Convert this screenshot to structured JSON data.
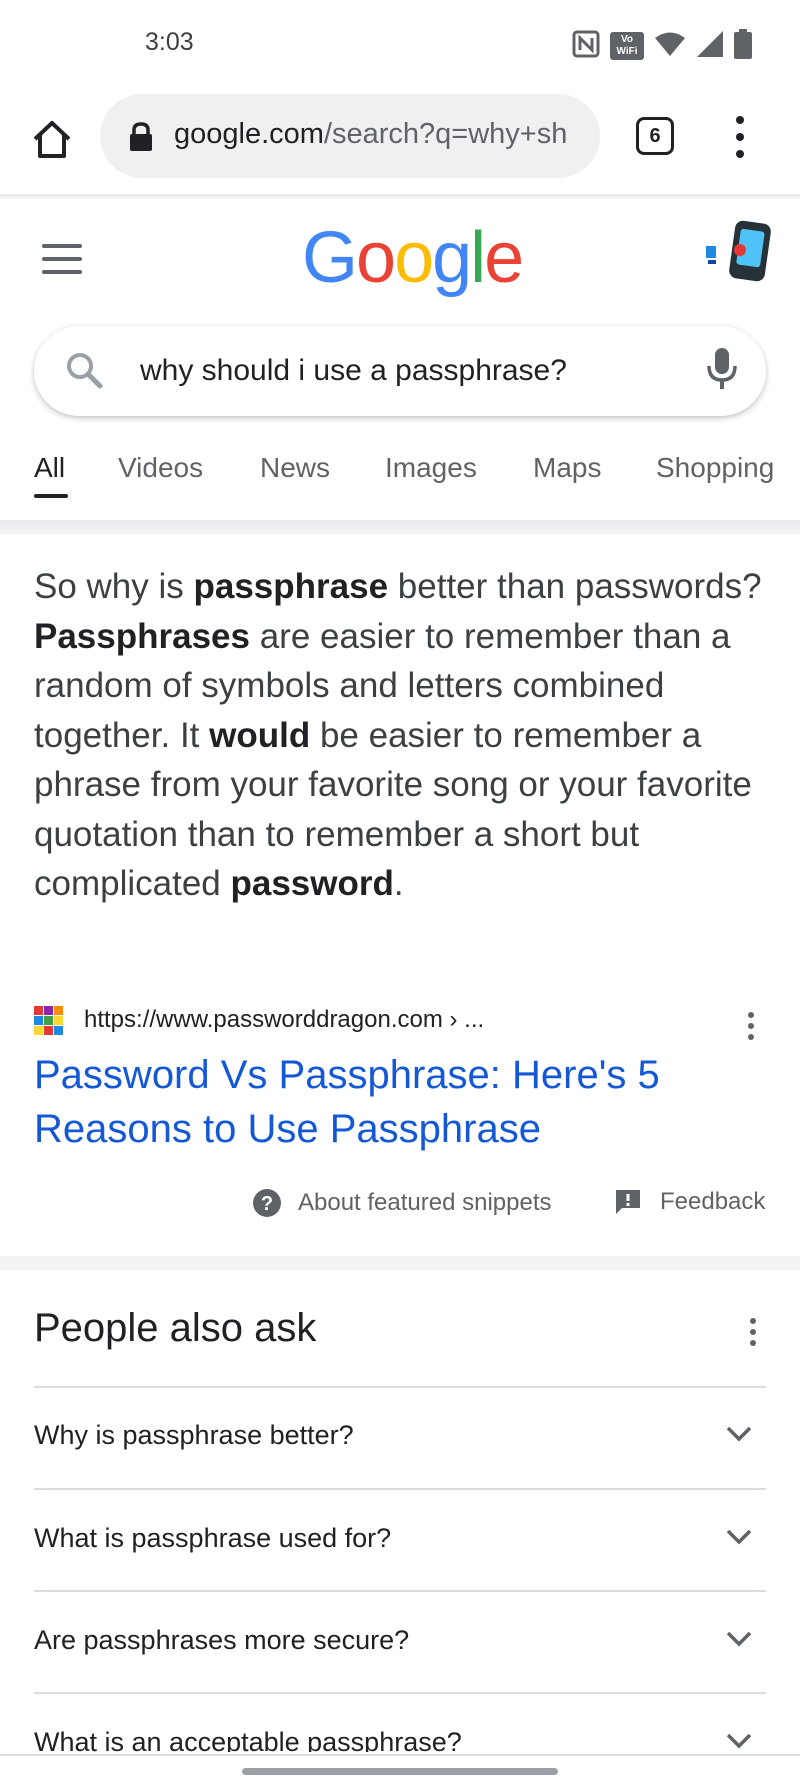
{
  "status_bar": {
    "time": "3:03",
    "icons": [
      "nfc-icon",
      "vowifi-icon",
      "wifi-icon",
      "cell-signal-icon",
      "battery-icon"
    ],
    "vowifi_top": "Vo",
    "vowifi_bottom": "WiFi"
  },
  "browser": {
    "url_domain": "google.com",
    "url_path": "/search?q=why+sh",
    "tab_count": "6"
  },
  "google": {
    "logo_letters": [
      "G",
      "o",
      "o",
      "g",
      "l",
      "e"
    ],
    "logo_colors": [
      "#4285F4",
      "#EA4335",
      "#FBBC05",
      "#4285F4",
      "#34A853",
      "#EA4335"
    ],
    "query": "why should i use a passphrase?"
  },
  "tabs": [
    {
      "label": "All",
      "active": true
    },
    {
      "label": "Videos"
    },
    {
      "label": "News"
    },
    {
      "label": "Images"
    },
    {
      "label": "Maps"
    },
    {
      "label": "Shopping"
    }
  ],
  "snippet": {
    "parts": [
      {
        "text": "So why is ",
        "bold": false
      },
      {
        "text": "passphrase",
        "bold": true
      },
      {
        "text": " better than passwords? ",
        "bold": false
      },
      {
        "text": "Passphrases",
        "bold": true
      },
      {
        "text": " are easier to remember than a random of symbols and letters combined together. It ",
        "bold": false
      },
      {
        "text": "would",
        "bold": true
      },
      {
        "text": " be easier to remember a phrase from your favorite song or your favorite quotation than to remember a short but complicated ",
        "bold": false
      },
      {
        "text": "password",
        "bold": true
      },
      {
        "text": ".",
        "bold": false
      }
    ],
    "source_url": "https://www.passworddragon.com › ...",
    "title": "Password Vs Passphrase: Here's 5 Reasons to Use Passphrase",
    "about_label": "About featured snippets",
    "feedback_label": "Feedback"
  },
  "people_also_ask": {
    "title": "People also ask",
    "questions": [
      "Why is passphrase better?",
      "What is passphrase used for?",
      "Are passphrases more secure?",
      "What is an acceptable passphrase?"
    ]
  },
  "colors": {
    "link": "#1558d6",
    "text": "#202124",
    "secondary": "#5f6368"
  }
}
